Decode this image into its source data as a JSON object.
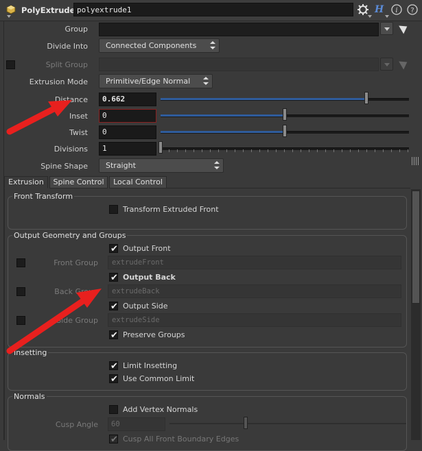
{
  "header": {
    "node_type": "PolyExtrude",
    "node_name": "polyextrude1",
    "icons": [
      "node-icon",
      "gear-icon",
      "help-h-icon",
      "info-icon",
      "question-icon"
    ]
  },
  "params": {
    "group_label": "Group",
    "divide_into_label": "Divide Into",
    "divide_into_value": "Connected Components",
    "split_group_label": "Split Group",
    "extrusion_mode_label": "Extrusion Mode",
    "extrusion_mode_value": "Primitive/Edge Normal",
    "distance_label": "Distance",
    "distance_value": "0.662",
    "distance_level": 0.662,
    "inset_label": "Inset",
    "inset_value": "0",
    "twist_label": "Twist",
    "twist_value": "0",
    "divisions_label": "Divisions",
    "divisions_value": "1",
    "spine_shape_label": "Spine Shape",
    "spine_shape_value": "Straight"
  },
  "tabs": [
    "Extrusion",
    "Spine Control",
    "Local Control"
  ],
  "front_transform": {
    "title": "Front Transform",
    "transform_extruded_front": "Transform Extruded Front"
  },
  "output_geo": {
    "title": "Output Geometry and Groups",
    "output_front": "Output Front",
    "front_group_label": "Front Group",
    "front_group_value": "extrudeFront",
    "output_back": "Output Back",
    "back_group_label": "Back Group",
    "back_group_value": "extrudeBack",
    "output_side": "Output Side",
    "side_group_label": "Side Group",
    "side_group_value": "extrudeSide",
    "preserve_groups": "Preserve Groups"
  },
  "insetting": {
    "title": "Insetting",
    "limit_insetting": "Limit Insetting",
    "use_common_limit": "Use Common Limit"
  },
  "normals": {
    "title": "Normals",
    "add_vertex_normals": "Add Vertex Normals",
    "cusp_angle_label": "Cusp Angle",
    "cusp_angle_value": "60",
    "cusp_front_edges": "Cusp All Front Boundary Edges"
  },
  "colors": {
    "annotation_arrow": "#e8201e",
    "slider_fill": "#2f5c9c"
  }
}
